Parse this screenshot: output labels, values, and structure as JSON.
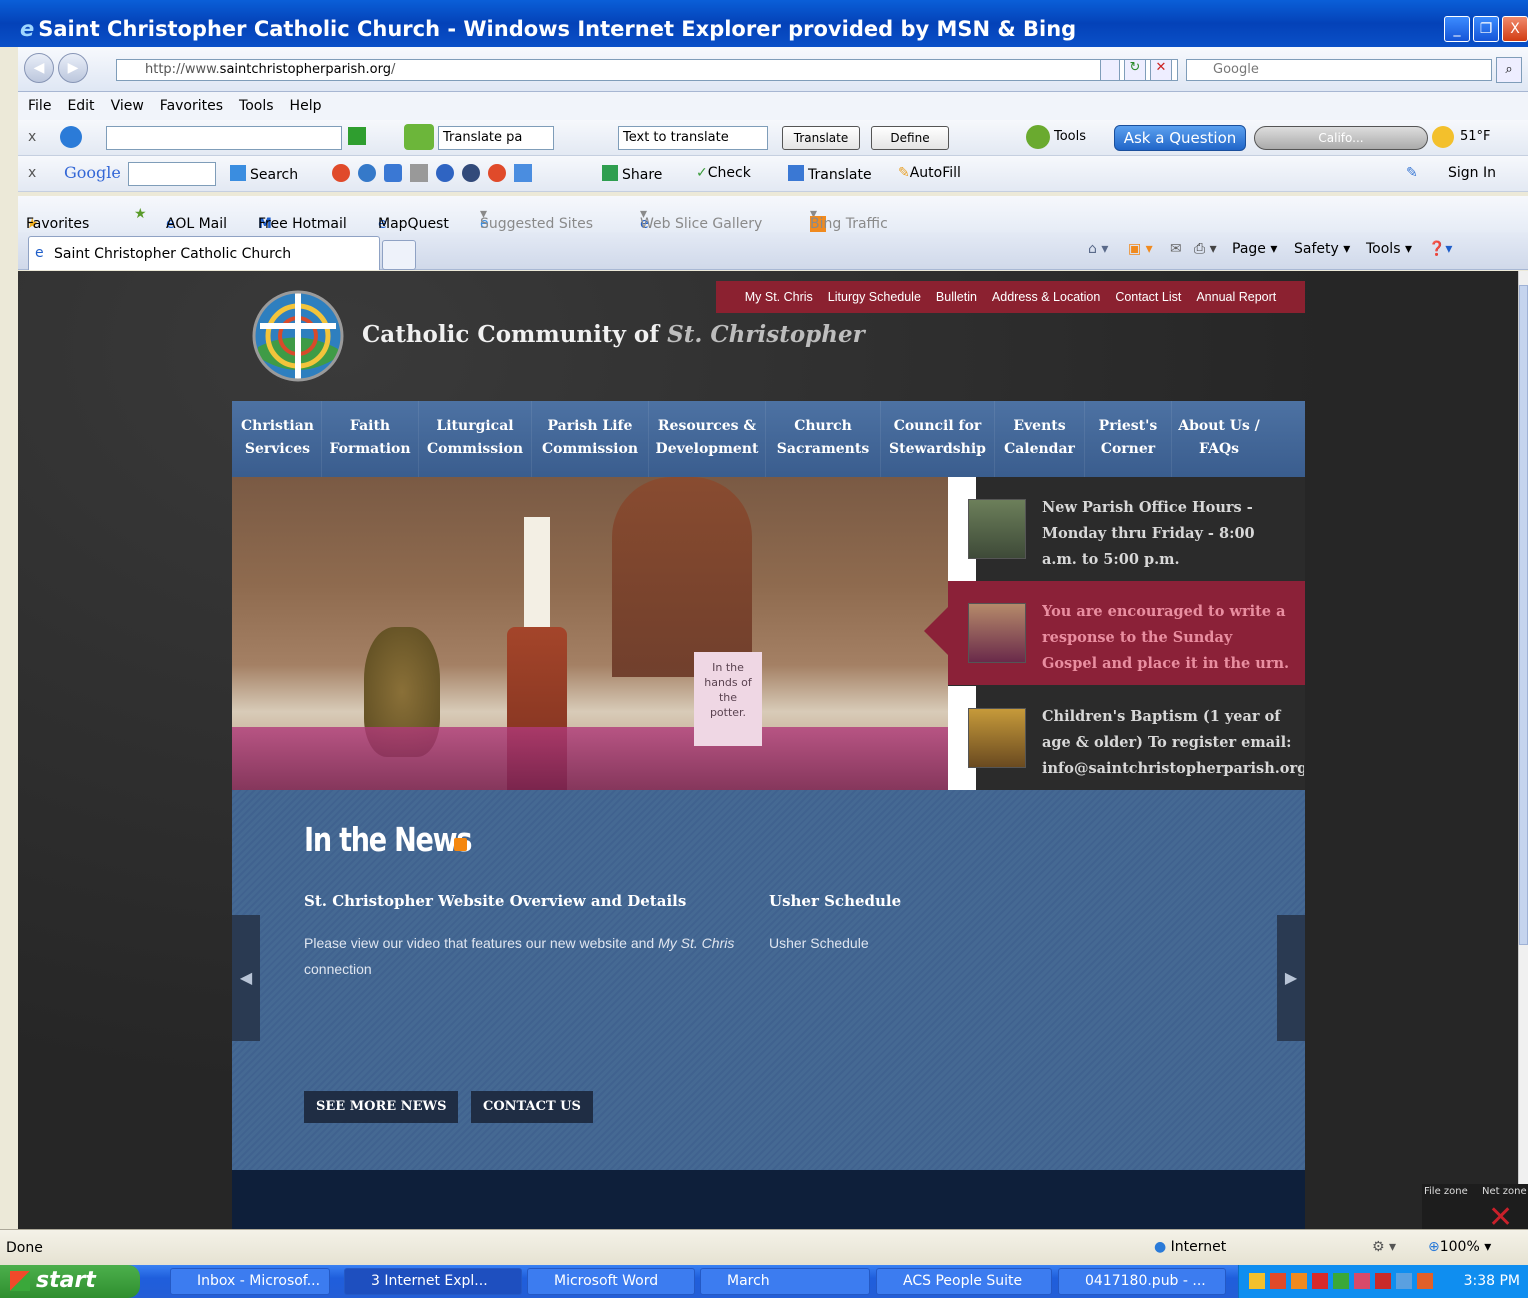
{
  "window": {
    "title": "Saint Christopher Catholic Church - Windows Internet Explorer provided by MSN & Bing",
    "controls": [
      "_",
      "❐",
      "X"
    ]
  },
  "address": {
    "url_prefix": "http://www.",
    "url_domain": "saintchristopherparish.org",
    "url_suffix": "/",
    "search_placeholder": "Google"
  },
  "menu": [
    "File",
    "Edit",
    "View",
    "Favorites",
    "Tools",
    "Help"
  ],
  "toolbar1": {
    "close": "x",
    "translate_select": "Translate pa",
    "text_input": "Text to translate",
    "translate_button": "Translate",
    "define_button": "Define",
    "tools": "Tools",
    "ask": "Ask a Question",
    "radio": "Califo...",
    "weather": "51°F"
  },
  "toolbar2": {
    "close": "x",
    "google": "Google",
    "search": "Search",
    "share": "Share",
    "check": "Check",
    "translate": "Translate",
    "autofill": "AutoFill",
    "signin": "Sign In"
  },
  "favorites": {
    "label": "Favorites",
    "items": [
      "AOL Mail",
      "Free Hotmail",
      "MapQuest",
      "Suggested Sites",
      "Web Slice Gallery",
      "Bing Traffic"
    ]
  },
  "tab": {
    "title": "Saint Christopher Catholic Church"
  },
  "command_bar": {
    "page": "Page",
    "safety": "Safety",
    "tools": "Tools"
  },
  "site": {
    "top_links": [
      "My St. Chris",
      "Liturgy Schedule",
      "Bulletin",
      "Address & Location",
      "Contact List",
      "Annual Report"
    ],
    "title_main": "Catholic Community of ",
    "title_italic": "St. Christopher",
    "nav": [
      {
        "l1": "Christian",
        "l2": "Services"
      },
      {
        "l1": "Faith",
        "l2": "Formation"
      },
      {
        "l1": "Liturgical",
        "l2": "Commission"
      },
      {
        "l1": "Parish Life",
        "l2": "Commission"
      },
      {
        "l1": "Resources &",
        "l2": "Development"
      },
      {
        "l1": "Church",
        "l2": "Sacraments"
      },
      {
        "l1": "Council for",
        "l2": "Stewardship"
      },
      {
        "l1": "Events",
        "l2": "Calendar"
      },
      {
        "l1": "Priest's",
        "l2": "Corner"
      },
      {
        "l1": "About Us /",
        "l2": "FAQs"
      }
    ],
    "hero_sign": [
      "In the",
      "hands of",
      "the",
      "potter."
    ],
    "slides": [
      {
        "l1": "New Parish Office Hours -",
        "l2": "Monday thru Friday - 8:00",
        "l3": "a.m. to 5:00 p.m."
      },
      {
        "l1": "You are encouraged to write a",
        "l2": "response to the Sunday",
        "l3": "Gospel and place it in the urn."
      },
      {
        "l1": "Children's Baptism (1 year of",
        "l2": "age & older) To register email:",
        "l3": "info@saintchristopherparish.org"
      }
    ],
    "news": {
      "heading": "In the News",
      "articles": [
        {
          "title": "St. Christopher Website Overview and Details",
          "body_a": "Please view our video that features our new website and ",
          "body_italic": "My St. Chris",
          "body_b": "connection"
        },
        {
          "title": "Usher Schedule",
          "body": "Usher Schedule"
        }
      ],
      "see_more": "SEE MORE NEWS",
      "contact": "CONTACT US"
    }
  },
  "status": {
    "text": "Done",
    "zone": "Internet",
    "zoom": "100%"
  },
  "dock": {
    "a": "File zone",
    "b": "Net zone"
  },
  "taskbar": {
    "start": "start",
    "items": [
      "Inbox - Microsof...",
      "3 Internet Expl...",
      "Microsoft Word",
      "March",
      "ACS People Suite",
      "0417180.pub - ..."
    ],
    "clock": "3:38 PM"
  }
}
